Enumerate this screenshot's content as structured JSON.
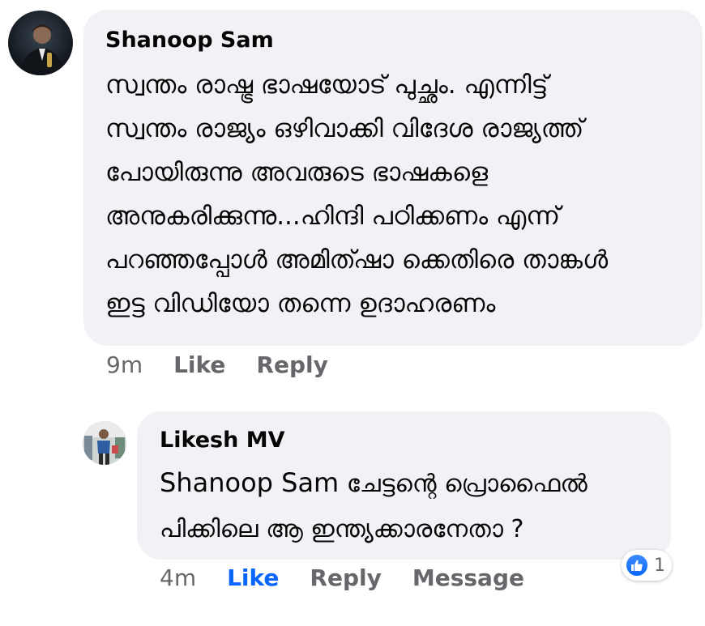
{
  "comment": {
    "author": "Shanoop Sam",
    "lines": [
      "സ്വന്തം രാഷ്ട്ര ഭാഷയോട് പുച്ഛം. എന്നിട്ട്",
      "സ്വന്തം രാജ്യം ഒഴിവാക്കി വിദേശ രാജ്യത്ത്",
      "പോയിരുന്നു അവരുടെ ഭാഷകളെ",
      "അനുകരിക്കുന്നു...ഹിന്ദി പഠിക്കണം എന്ന്",
      "പറഞ്ഞപ്പോൾ അമിത്ഷാ ക്കെതിരെ താങ്കൾ",
      "ഇട്ട വിഡിയോ തന്നെ ഉദാഹരണം"
    ],
    "time": "9m",
    "like_label": "Like",
    "reply_label": "Reply"
  },
  "reply": {
    "author": "Likesh MV",
    "mention": "Shanoop Sam",
    "line1_rest": " ചേട്ടന്റെ പ്രൊഫൈൽ",
    "line2": "പിക്കിലെ ആ ഇന്ത്യക്കാരനേതാ ?",
    "time": "4m",
    "like_label": "Like",
    "reply_label": "Reply",
    "message_label": "Message",
    "reaction_count": "1"
  },
  "colors": {
    "bubble": "#f0f2f5",
    "meta": "#65676b",
    "liked": "#0866ff"
  }
}
